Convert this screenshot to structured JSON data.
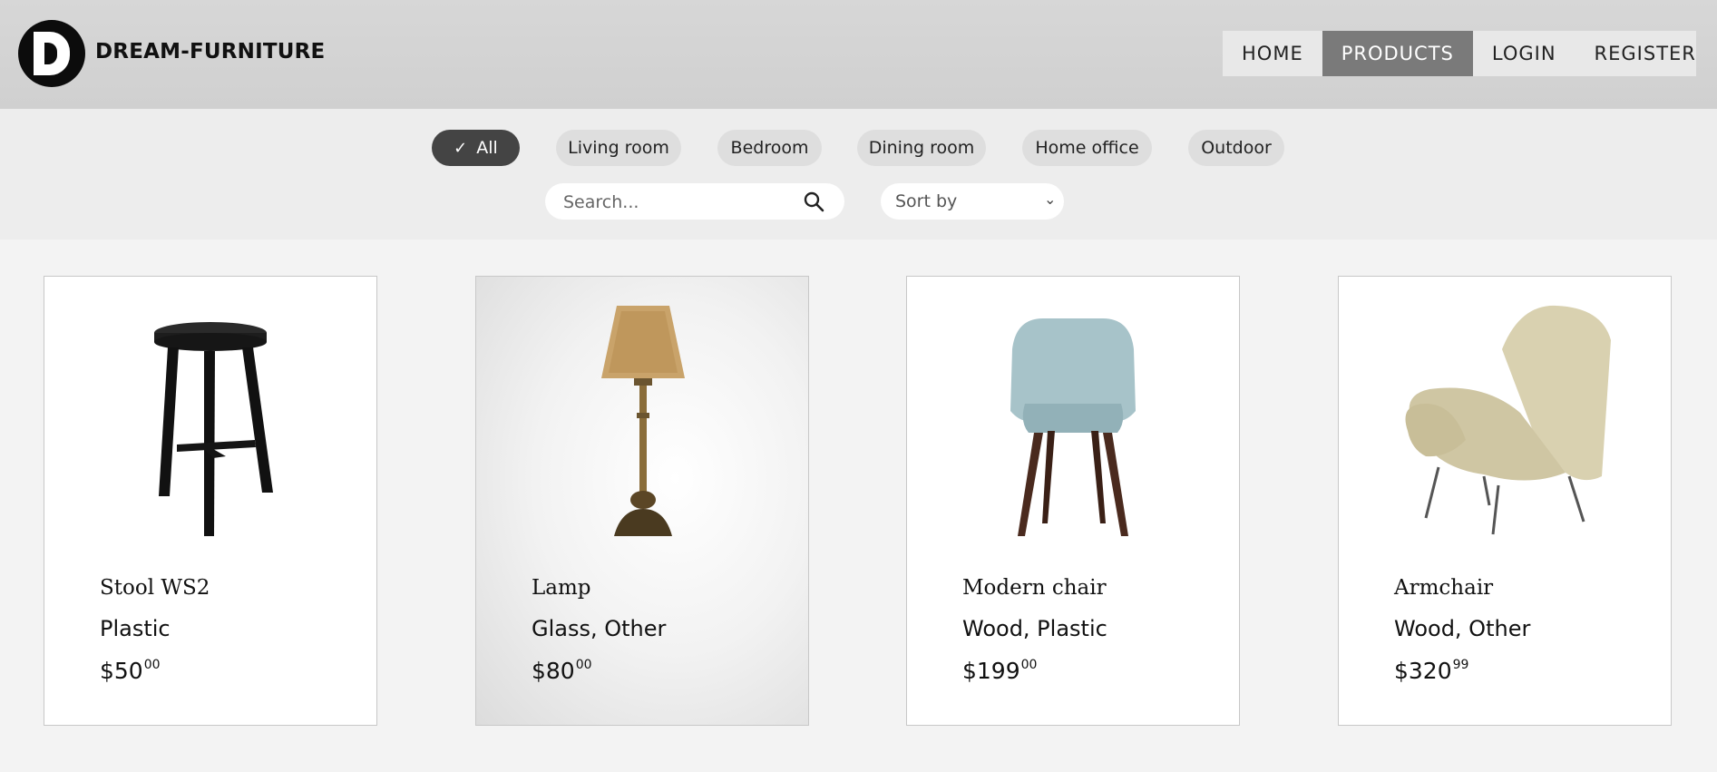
{
  "brand": {
    "name": "DREAM-FURNITURE",
    "logo_letter": "D"
  },
  "nav": [
    {
      "label": "HOME",
      "active": false
    },
    {
      "label": "PRODUCTS",
      "active": true
    },
    {
      "label": "LOGIN",
      "active": false
    },
    {
      "label": "REGISTER",
      "active": false
    }
  ],
  "categories": [
    {
      "label": "All",
      "active": true
    },
    {
      "label": "Living room",
      "active": false
    },
    {
      "label": "Bedroom",
      "active": false
    },
    {
      "label": "Dining room",
      "active": false
    },
    {
      "label": "Home office",
      "active": false
    },
    {
      "label": "Outdoor",
      "active": false
    }
  ],
  "search": {
    "placeholder": "Search...",
    "value": ""
  },
  "sort": {
    "label": "Sort by"
  },
  "products": [
    {
      "name": "Stool WS2",
      "material": "Plastic",
      "price_main": "$50",
      "price_cents": "00",
      "image": "stool"
    },
    {
      "name": "Lamp",
      "material": "Glass, Other",
      "price_main": "$80",
      "price_cents": "00",
      "image": "lamp",
      "highlighted": true
    },
    {
      "name": "Modern chair",
      "material": "Wood, Plastic",
      "price_main": "$199",
      "price_cents": "00",
      "image": "modern-chair"
    },
    {
      "name": "Armchair",
      "material": "Wood, Other",
      "price_main": "$320",
      "price_cents": "99",
      "image": "armchair"
    }
  ],
  "colors": {
    "header": "#d4d4d4",
    "nav_active": "#7a7a7a",
    "chip_active": "#444444",
    "chip": "#dedede"
  }
}
